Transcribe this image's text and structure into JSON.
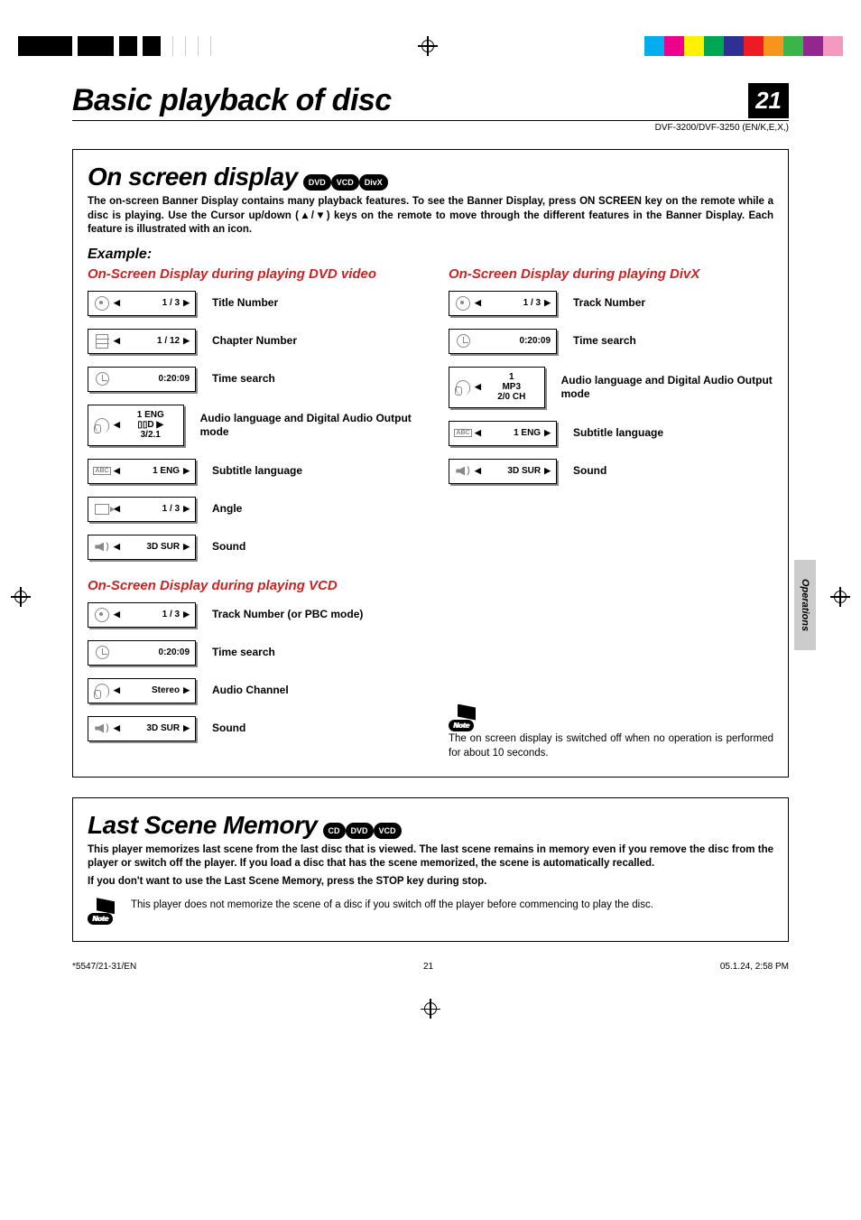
{
  "header": {
    "title": "Basic playback of disc",
    "page_number": "21",
    "model_info": "DVF-3200/DVF-3250 (EN/K,E,X,)"
  },
  "colorbar": [
    "#00aeef",
    "#ec008c",
    "#fff200",
    "#00a651",
    "#2e3192",
    "#ed1c24",
    "#f7941d",
    "#39b54a",
    "#92278f",
    "#f49ac1"
  ],
  "section1": {
    "title": "On screen display",
    "badges": [
      "DVD",
      "VCD",
      "DivX"
    ],
    "intro": "The on-screen Banner Display contains many playback features. To see the Banner Display, press ON SCREEN key on the remote while a disc is playing. Use the Cursor up/down (▲/▼) keys on the remote to move through the different features in the Banner Display. Each feature is illustrated with an icon.",
    "example_label": "Example:",
    "dvd": {
      "heading": "On-Screen Display during playing DVD video",
      "rows": [
        {
          "val": "1 / 3",
          "arrows": "lr",
          "desc": "Title Number",
          "icon": "disc"
        },
        {
          "val": "1 / 12",
          "arrows": "lr",
          "desc": "Chapter Number",
          "icon": "chap"
        },
        {
          "val": "0:20:09",
          "arrows": "",
          "desc": "Time search",
          "icon": "clock"
        },
        {
          "val": "1 ENG\n▯▯D ▶\n3/2.1",
          "arrows": "l",
          "desc": "Audio language and Digital Audio Output mode",
          "icon": "head",
          "tall": true
        },
        {
          "val": "1 ENG",
          "arrows": "lr",
          "desc": "Subtitle language",
          "icon": "abc"
        },
        {
          "val": "1 / 3",
          "arrows": "lr",
          "desc": "Angle",
          "icon": "cam"
        },
        {
          "val": "3D SUR",
          "arrows": "lr",
          "desc": "Sound",
          "icon": "spk"
        }
      ]
    },
    "divx": {
      "heading": "On-Screen Display during playing DivX",
      "rows": [
        {
          "val": "1 / 3",
          "arrows": "lr",
          "desc": "Track Number",
          "icon": "disc"
        },
        {
          "val": "0:20:09",
          "arrows": "",
          "desc": "Time search",
          "icon": "clock"
        },
        {
          "val": "1\nMP3\n2/0 CH",
          "arrows": "l",
          "desc": "Audio language and Digital Audio Output mode",
          "icon": "head",
          "tall": true
        },
        {
          "val": "1 ENG",
          "arrows": "lr",
          "desc": "Subtitle language",
          "icon": "abc"
        },
        {
          "val": "3D SUR",
          "arrows": "lr",
          "desc": "Sound",
          "icon": "spk"
        }
      ]
    },
    "vcd": {
      "heading": "On-Screen Display during playing VCD",
      "rows": [
        {
          "val": "1 / 3",
          "arrows": "lr",
          "desc": "Track Number (or PBC mode)",
          "icon": "disc"
        },
        {
          "val": "0:20:09",
          "arrows": "",
          "desc": "Time search",
          "icon": "clock"
        },
        {
          "val": "Stereo",
          "arrows": "lr",
          "desc": "Audio Channel",
          "icon": "head"
        },
        {
          "val": "3D SUR",
          "arrows": "lr",
          "desc": "Sound",
          "icon": "spk"
        }
      ]
    },
    "note_label": "Note",
    "note_text": "The on screen display is switched off when no operation is performed for about 10 seconds."
  },
  "section2": {
    "title": "Last Scene Memory",
    "badges": [
      "CD",
      "DVD",
      "VCD"
    ],
    "intro": "This player memorizes last scene from the last disc that is viewed. The last scene remains in memory even if you remove the disc from the player or switch off the player. If you load a disc that has the scene memorized, the scene is automatically recalled.",
    "intro2": "If you don't want to use the Last Scene Memory, press the STOP key during stop.",
    "note_label": "Note",
    "note_text": "This player does not memorize the scene of a disc if you switch off the player before commencing to play the disc."
  },
  "side_tab": "Operations",
  "footer": {
    "left": "*5547/21-31/EN",
    "center": "21",
    "right": "05.1.24, 2:58 PM"
  }
}
